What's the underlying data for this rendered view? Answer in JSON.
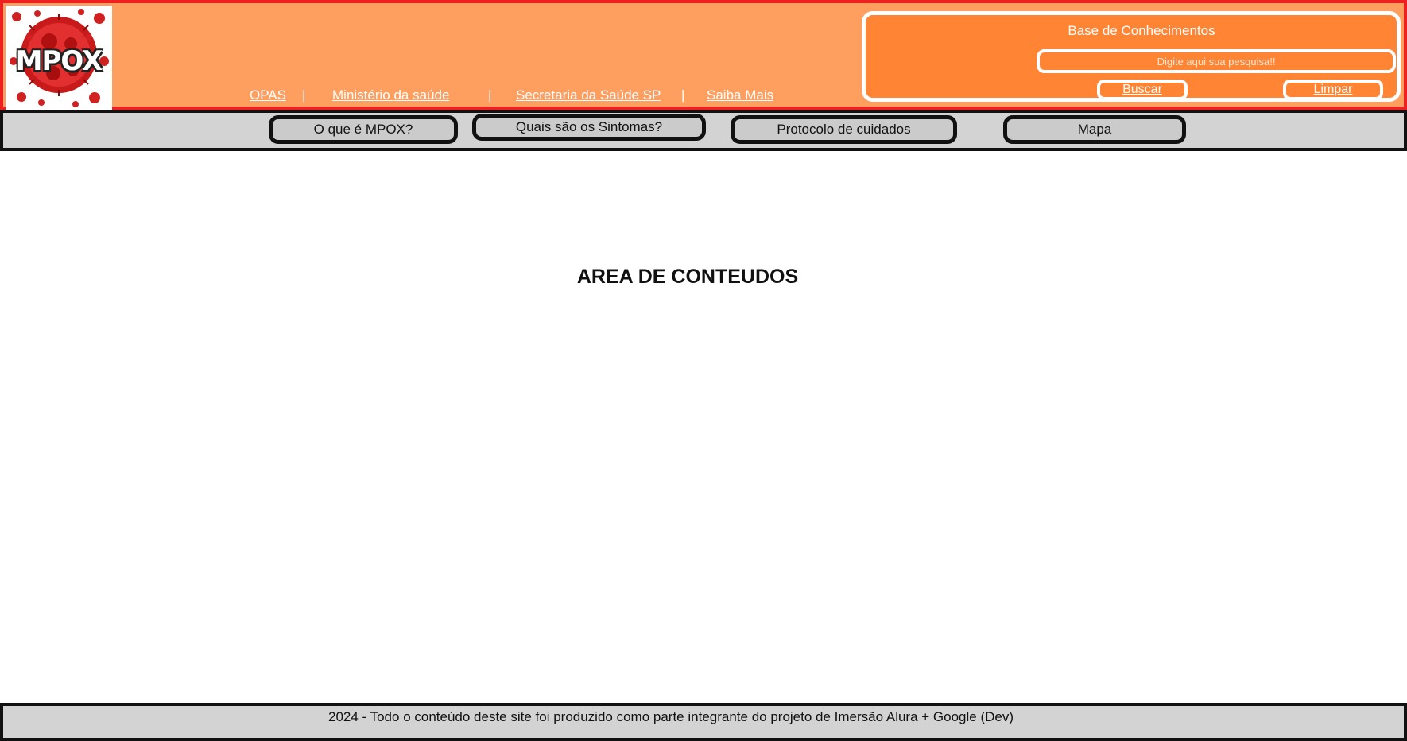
{
  "header": {
    "logo_text": "MPOX",
    "links": [
      "OPAS",
      "Ministério da saúde",
      "Secretaria da Saúde SP",
      "Saiba Mais"
    ],
    "separator": "|"
  },
  "knowledge_base": {
    "title": "Base de Conhecimentos",
    "search_placeholder": "Digite aqui sua pesquisa!!",
    "search_button": "Buscar",
    "clear_button": "Limpar"
  },
  "nav": {
    "items": [
      "O que é MPOX?",
      "Quais são os Sintomas?",
      "Protocolo de cuidados",
      "Mapa"
    ]
  },
  "content": {
    "title": "AREA DE CONTEUDOS"
  },
  "footer": {
    "text": "2024 - Todo o conteúdo deste site foi produzido como parte integrante do projeto de Imersão Alura + Google (Dev)"
  },
  "colors": {
    "header_bg": "#ff9f5f",
    "header_border": "#ee2020",
    "search_panel_bg": "#ff8534",
    "nav_bg": "#d3d3d3",
    "logo_virus": "#d01818"
  }
}
